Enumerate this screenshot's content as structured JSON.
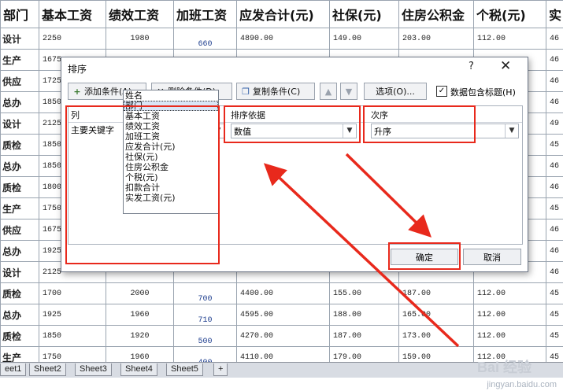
{
  "sheet": {
    "headers": [
      "部门",
      "基本工资",
      "绩效工资",
      "加班工资",
      "应发合计(元)",
      "社保(元)",
      "住房公积金",
      "个税(元)",
      "实"
    ],
    "rows": [
      {
        "dept": "设计",
        "base": "2250",
        "perf": "1980",
        "ot": "660",
        "gross": "4890.00",
        "social": "149.00",
        "fund": "203.00",
        "tax": "112.00",
        "net": "46"
      },
      {
        "dept": "生产",
        "base": "1675",
        "perf": "",
        "ot": "",
        "gross": "",
        "social": "",
        "fund": "",
        "tax": "",
        "net": "46"
      },
      {
        "dept": "供应",
        "base": "1725",
        "perf": "",
        "ot": "",
        "gross": "",
        "social": "",
        "fund": "",
        "tax": "",
        "net": "46"
      },
      {
        "dept": "总办",
        "base": "1850",
        "perf": "",
        "ot": "",
        "gross": "",
        "social": "",
        "fund": "",
        "tax": "",
        "net": "46"
      },
      {
        "dept": "设计",
        "base": "2125",
        "perf": "",
        "ot": "",
        "gross": "",
        "social": "",
        "fund": "",
        "tax": "",
        "net": "49"
      },
      {
        "dept": "质检",
        "base": "1850",
        "perf": "",
        "ot": "",
        "gross": "",
        "social": "",
        "fund": "",
        "tax": "",
        "net": "45"
      },
      {
        "dept": "总办",
        "base": "1850",
        "perf": "",
        "ot": "",
        "gross": "",
        "social": "",
        "fund": "",
        "tax": "",
        "net": "46"
      },
      {
        "dept": "质检",
        "base": "1800",
        "perf": "",
        "ot": "",
        "gross": "",
        "social": "",
        "fund": "",
        "tax": "",
        "net": "46"
      },
      {
        "dept": "生产",
        "base": "1750",
        "perf": "",
        "ot": "",
        "gross": "",
        "social": "",
        "fund": "",
        "tax": "",
        "net": "45"
      },
      {
        "dept": "供应",
        "base": "1675",
        "perf": "",
        "ot": "",
        "gross": "",
        "social": "",
        "fund": "",
        "tax": "",
        "net": "46"
      },
      {
        "dept": "总办",
        "base": "1925",
        "perf": "",
        "ot": "",
        "gross": "",
        "social": "",
        "fund": "",
        "tax": "",
        "net": "46"
      },
      {
        "dept": "设计",
        "base": "2125",
        "perf": "",
        "ot": "",
        "gross": "",
        "social": "",
        "fund": "",
        "tax": "",
        "net": "46"
      },
      {
        "dept": "质检",
        "base": "1700",
        "perf": "2000",
        "ot": "700",
        "gross": "4400.00",
        "social": "155.00",
        "fund": "187.00",
        "tax": "112.00",
        "net": "45"
      },
      {
        "dept": "总办",
        "base": "1925",
        "perf": "1960",
        "ot": "710",
        "gross": "4595.00",
        "social": "188.00",
        "fund": "165.00",
        "tax": "112.00",
        "net": "45"
      },
      {
        "dept": "质检",
        "base": "1850",
        "perf": "1920",
        "ot": "500",
        "gross": "4270.00",
        "social": "187.00",
        "fund": "173.00",
        "tax": "112.00",
        "net": "45"
      },
      {
        "dept": "生产",
        "base": "1750",
        "perf": "1960",
        "ot": "400",
        "gross": "4110.00",
        "social": "179.00",
        "fund": "159.00",
        "tax": "112.00",
        "net": "45"
      }
    ]
  },
  "tabs": [
    "eet1",
    "Sheet2",
    "Sheet3",
    "Sheet4",
    "Sheet5"
  ],
  "watermark": {
    "logo": "Bai 经验",
    "url": "jingyan.baidu.com"
  },
  "dialog": {
    "title": "排序",
    "help": "?",
    "close": "✕",
    "toolbar": {
      "add": "添加条件(A)",
      "delete": "删除条件(D)",
      "copy": "复制条件(C)",
      "up": "▲",
      "down": "▼",
      "options": "选项(O)...",
      "has_header_checked": true,
      "has_header": "数据包含标题(H)"
    },
    "columns": {
      "col": "列",
      "basis": "排序依据",
      "order": "次序"
    },
    "key_label": "主要关键字",
    "key_value": "部门",
    "basis_value": "数值",
    "order_value": "升序",
    "list_items": [
      "姓名",
      "部门",
      "基本工资",
      "绩效工资",
      "加班工资",
      "应发合计(元)",
      "社保(元)",
      "住房公积金",
      "个税(元)",
      "扣款合计",
      "实发工资(元)"
    ],
    "selected_item": "部门",
    "ok": "确定",
    "cancel": "取消"
  },
  "colors": {
    "highlight": "#e8291c",
    "selection": "#d9e6f7"
  }
}
